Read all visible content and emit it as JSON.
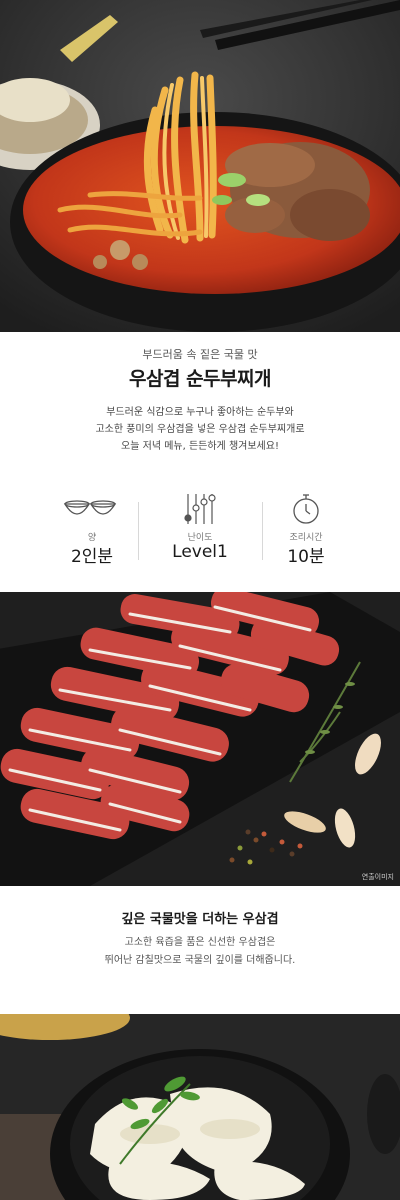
{
  "intro": {
    "subtitle": "부드러움 속 짙은 국물 맛",
    "title": "우삼겹 순두부찌개",
    "description": [
      "부드러운 식감으로 누구나 좋아하는 순두부와",
      "고소한 풍미의 우삼겹을 넣은 우삼겹 순두부찌개로",
      "오늘 저녁 메뉴, 든든하게 챙겨보세요!"
    ]
  },
  "stats": [
    {
      "icon": "two-bowls-icon",
      "label": "양",
      "value": "2인분"
    },
    {
      "icon": "sliders-icon",
      "label": "난이도",
      "value": "Level1"
    },
    {
      "icon": "stopwatch-icon",
      "label": "조리시간",
      "value": "10분"
    }
  ],
  "pork_photo": {
    "caption": "연출이미지"
  },
  "section2": {
    "heading": "깊은 국물맛을 더하는 우삼겹",
    "body": [
      "고소한 육즙을 품은 신선한 우삼겹은",
      "뛰어난 감칠맛으로 국물의 깊이를 더해줍니다."
    ]
  }
}
